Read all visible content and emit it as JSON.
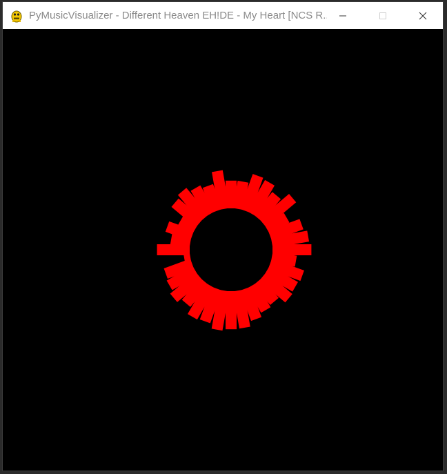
{
  "window": {
    "title": "PyMusicVisualizer - Different Heaven EH!DE - My Heart [NCS R...",
    "app_icon": "pygame-snake-icon",
    "controls": {
      "minimize_icon": "minimize-icon",
      "maximize_icon": "maximize-icon",
      "close_icon": "close-icon"
    }
  },
  "visualizer": {
    "background_color": "#000000",
    "bar_color": "#ff0000",
    "bar_count": 36,
    "start_angle_deg": 0,
    "direction": "clockwise",
    "levels": [
      0.94,
      0.59,
      0.83,
      0.79,
      0.82,
      0.63,
      0.68,
      0.78,
      0.91,
      0.92,
      0.96,
      0.84,
      0.87,
      0.69,
      0.81,
      0.72,
      0.68,
      0.15,
      0.79,
      0.47,
      0.64,
      0.41,
      0.77,
      0.84,
      0.72,
      0.64,
      0.93,
      0.67,
      0.67,
      0.9,
      0.87,
      0.71,
      0.94,
      0.55,
      0.81,
      0.89
    ]
  }
}
